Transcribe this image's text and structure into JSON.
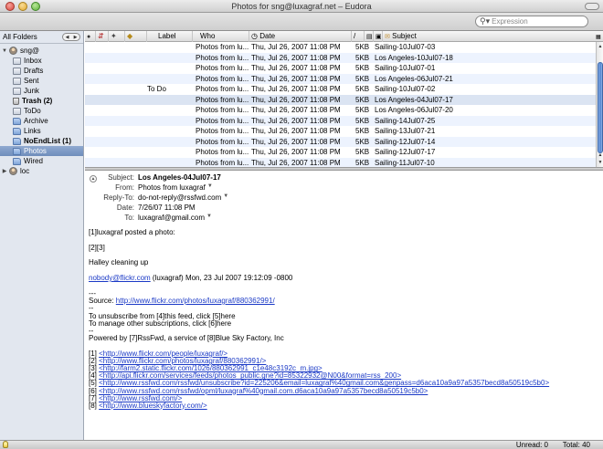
{
  "window": {
    "title": "Photos for sng@luxagraf.net – Eudora"
  },
  "search": {
    "placeholder": "Expression",
    "value": ""
  },
  "sidebar": {
    "header": "All Folders",
    "folders": [
      {
        "label": "sng@",
        "icon": "person-icon",
        "level": 0,
        "expanded": true,
        "bold": false,
        "selected": false
      },
      {
        "label": "Inbox",
        "icon": "mailbox-icon",
        "level": 1,
        "bold": false,
        "selected": false
      },
      {
        "label": "Drafts",
        "icon": "mailbox-icon",
        "level": 1,
        "bold": false,
        "selected": false
      },
      {
        "label": "Sent",
        "icon": "mailbox-icon",
        "level": 1,
        "bold": false,
        "selected": false
      },
      {
        "label": "Junk",
        "icon": "mailbox-icon",
        "level": 1,
        "bold": false,
        "selected": false
      },
      {
        "label": "Trash (2)",
        "icon": "trash-icon",
        "level": 1,
        "bold": true,
        "selected": false
      },
      {
        "label": "ToDo",
        "icon": "mailbox-icon",
        "level": 1,
        "bold": false,
        "selected": false
      },
      {
        "label": "Archive",
        "icon": "folder-icon",
        "level": 1,
        "bold": false,
        "selected": false
      },
      {
        "label": "Links",
        "icon": "folder-icon",
        "level": 1,
        "bold": false,
        "selected": false
      },
      {
        "label": "NoEndList (1)",
        "icon": "folder-icon",
        "level": 1,
        "bold": true,
        "selected": false
      },
      {
        "label": "Photos",
        "icon": "folder-icon",
        "level": 1,
        "bold": false,
        "selected": true
      },
      {
        "label": "Wired",
        "icon": "folder-icon",
        "level": 1,
        "bold": false,
        "selected": false
      },
      {
        "label": "loc",
        "icon": "person-icon",
        "level": 0,
        "expanded": false,
        "bold": false,
        "selected": false
      }
    ]
  },
  "message_list": {
    "columns": {
      "label": "Label",
      "who": "Who",
      "date": "Date",
      "size_sort": "/",
      "subject": "Subject"
    },
    "rows": [
      {
        "label": "",
        "who": "Photos from lu...",
        "date": "Thu, Jul 26, 2007 11:08 PM",
        "size": "5KB",
        "subject": "Sailing-10Jul07-03",
        "highlight": false
      },
      {
        "label": "",
        "who": "Photos from lu...",
        "date": "Thu, Jul 26, 2007 11:08 PM",
        "size": "5KB",
        "subject": "Los Angeles-10Jul07-18",
        "highlight": false
      },
      {
        "label": "",
        "who": "Photos from lu...",
        "date": "Thu, Jul 26, 2007 11:08 PM",
        "size": "5KB",
        "subject": "Sailing-10Jul07-01",
        "highlight": false
      },
      {
        "label": "",
        "who": "Photos from lu...",
        "date": "Thu, Jul 26, 2007 11:08 PM",
        "size": "5KB",
        "subject": "Los Angeles-06Jul07-21",
        "highlight": false
      },
      {
        "label": "To Do",
        "who": "Photos from lu...",
        "date": "Thu, Jul 26, 2007 11:08 PM",
        "size": "5KB",
        "subject": "Sailing-10Jul07-02",
        "highlight": false
      },
      {
        "label": "",
        "who": "Photos from lu...",
        "date": "Thu, Jul 26, 2007 11:08 PM",
        "size": "5KB",
        "subject": "Los Angeles-04Jul07-17",
        "highlight": true
      },
      {
        "label": "",
        "who": "Photos from lu...",
        "date": "Thu, Jul 26, 2007 11:08 PM",
        "size": "5KB",
        "subject": "Los Angeles-06Jul07-20",
        "highlight": false
      },
      {
        "label": "",
        "who": "Photos from lu...",
        "date": "Thu, Jul 26, 2007 11:08 PM",
        "size": "5KB",
        "subject": "Sailing-14Jul07-25",
        "highlight": false
      },
      {
        "label": "",
        "who": "Photos from lu...",
        "date": "Thu, Jul 26, 2007 11:08 PM",
        "size": "5KB",
        "subject": "Sailing-13Jul07-21",
        "highlight": false
      },
      {
        "label": "",
        "who": "Photos from lu...",
        "date": "Thu, Jul 26, 2007 11:08 PM",
        "size": "5KB",
        "subject": "Sailing-12Jul07-14",
        "highlight": false
      },
      {
        "label": "",
        "who": "Photos from lu...",
        "date": "Thu, Jul 26, 2007 11:08 PM",
        "size": "5KB",
        "subject": "Sailing-12Jul07-17",
        "highlight": false
      },
      {
        "label": "",
        "who": "Photos from lu...",
        "date": "Thu, Jul 26, 2007 11:08 PM",
        "size": "5KB",
        "subject": "Sailing-11Jul07-10",
        "highlight": false
      }
    ]
  },
  "preview": {
    "headers": [
      {
        "label": "Subject:",
        "value": "Los Angeles-04Jul07-17",
        "bold": true,
        "dropdown": false
      },
      {
        "label": "From:",
        "value": "Photos from luxagraf",
        "bold": false,
        "dropdown": true
      },
      {
        "label": "Reply-To:",
        "value": "do-not-reply@rssfwd.com",
        "bold": false,
        "dropdown": true
      },
      {
        "label": "Date:",
        "value": "7/26/07 11:08 PM",
        "bold": false,
        "dropdown": false
      },
      {
        "label": "To:",
        "value": "luxagraf@gmail.com",
        "bold": false,
        "dropdown": true
      }
    ],
    "body": {
      "posted": "[1]luxagraf posted a photo:",
      "refs": "[2][3]",
      "caption": "Halley cleaning up",
      "email_link": "nobody@flickr.com",
      "email_rest": " (luxagraf) Mon, 23 Jul 2007 19:12:09 -0800",
      "sep1": "---",
      "source_label": "Source: ",
      "source_link": "http://www.flickr.com/photos/luxagraf/880362991/",
      "sep2": "--",
      "unsub": "To unsubscribe from [4]this feed, click [5]here",
      "manage": "To manage other subscriptions, click [6]here",
      "sep3": "--",
      "powered": "Powered by [7]RssFwd, a service of [8]Blue Sky Factory, Inc",
      "links": [
        {
          "num": "[1] ",
          "url": "<http://www.flickr.com/people/luxagraf/>"
        },
        {
          "num": "[2] ",
          "url": "<http://www.flickr.com/photos/luxagraf/880362991/>"
        },
        {
          "num": "[3] ",
          "url": "<http://farm2.static.flickr.com/1026/880362991_c1e48c3192c_m.jpg>"
        },
        {
          "num": "[4] ",
          "url": "<http://api.flickr.com/services/feeds/photos_public.gne?id=85322932@N00&format=rss_200>"
        },
        {
          "num": "[5] ",
          "url": "<http://www.rssfwd.com/rssfwd/unsubscribe?id=225206&email=luxagraf%40gmail.com&genpass=d6aca10a9a97a5357becd8a50519c5b0>"
        },
        {
          "num": "[6] ",
          "url": "<http://www.rssfwd.com/rssfwd/opml/luxagraf%40gmail.com.d6aca10a9a97a5357becd8a50519c5b0>"
        },
        {
          "num": "[7] ",
          "url": "<http://www.rssfwd.com/>"
        },
        {
          "num": "[8] ",
          "url": "<http://www.blueskyfactory.com/>"
        }
      ]
    }
  },
  "status": {
    "unread": "Unread: 0",
    "total": "Total: 40"
  }
}
